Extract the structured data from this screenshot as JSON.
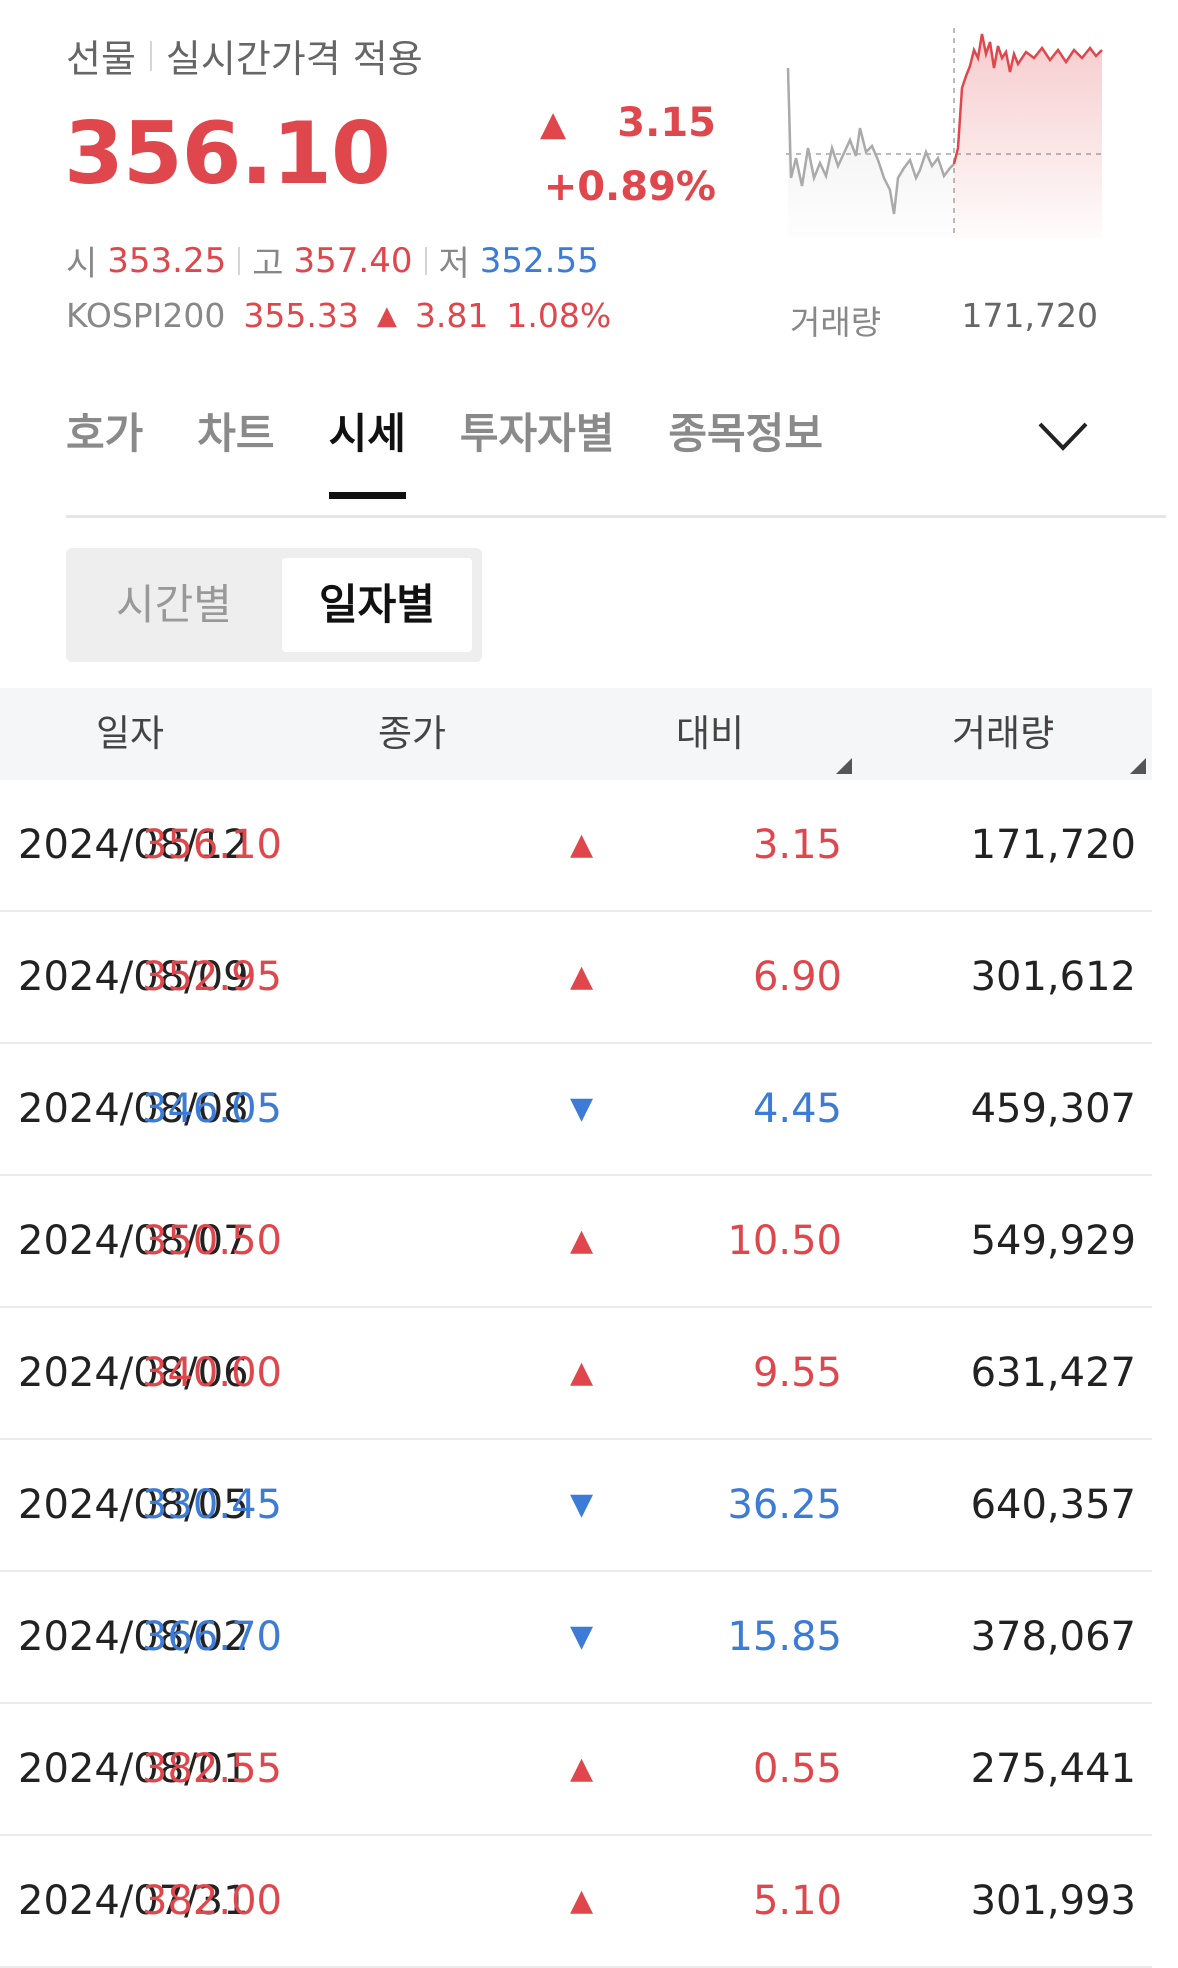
{
  "header": {
    "category": "선물",
    "mode": "실시간가격 적용",
    "price": "356.10",
    "change_arrow": "▲",
    "change": "3.15",
    "change_pct": "+0.89%",
    "open_label": "시",
    "open": "353.25",
    "high_label": "고",
    "high": "357.40",
    "low_label": "저",
    "low": "352.55",
    "index_name": "KOSPI200",
    "index_price": "355.33",
    "index_arrow": "▲",
    "index_change": "3.81",
    "index_pct": "1.08%",
    "volume_label": "거래량",
    "volume": "171,720"
  },
  "colors": {
    "up": "#e0474c",
    "down": "#3c7bd6"
  },
  "tabs": [
    {
      "label": "호가",
      "active": false
    },
    {
      "label": "차트",
      "active": false
    },
    {
      "label": "시세",
      "active": true
    },
    {
      "label": "투자자별",
      "active": false
    },
    {
      "label": "종목정보",
      "active": false
    }
  ],
  "tabs_expand_icon": "chevron-down-icon",
  "segment": {
    "options": [
      "시간별",
      "일자별"
    ],
    "selected": "일자별"
  },
  "table": {
    "columns": [
      "일자",
      "종가",
      "대비",
      "거래량"
    ],
    "rows": [
      {
        "date": "2024/08/12",
        "close": "356.10",
        "dir": "up",
        "arrow": "▲",
        "diff": "3.15",
        "volume": "171,720"
      },
      {
        "date": "2024/08/09",
        "close": "352.95",
        "dir": "up",
        "arrow": "▲",
        "diff": "6.90",
        "volume": "301,612"
      },
      {
        "date": "2024/08/08",
        "close": "346.05",
        "dir": "down",
        "arrow": "▼",
        "diff": "4.45",
        "volume": "459,307"
      },
      {
        "date": "2024/08/07",
        "close": "350.50",
        "dir": "up",
        "arrow": "▲",
        "diff": "10.50",
        "volume": "549,929"
      },
      {
        "date": "2024/08/06",
        "close": "340.00",
        "dir": "up",
        "arrow": "▲",
        "diff": "9.55",
        "volume": "631,427"
      },
      {
        "date": "2024/08/05",
        "close": "330.45",
        "dir": "down",
        "arrow": "▼",
        "diff": "36.25",
        "volume": "640,357"
      },
      {
        "date": "2024/08/02",
        "close": "366.70",
        "dir": "down",
        "arrow": "▼",
        "diff": "15.85",
        "volume": "378,067"
      },
      {
        "date": "2024/08/01",
        "close": "382.55",
        "dir": "up",
        "arrow": "▲",
        "diff": "0.55",
        "volume": "275,441"
      },
      {
        "date": "2024/07/31",
        "close": "382.00",
        "dir": "up",
        "arrow": "▲",
        "diff": "5.10",
        "volume": "301,993"
      }
    ]
  }
}
